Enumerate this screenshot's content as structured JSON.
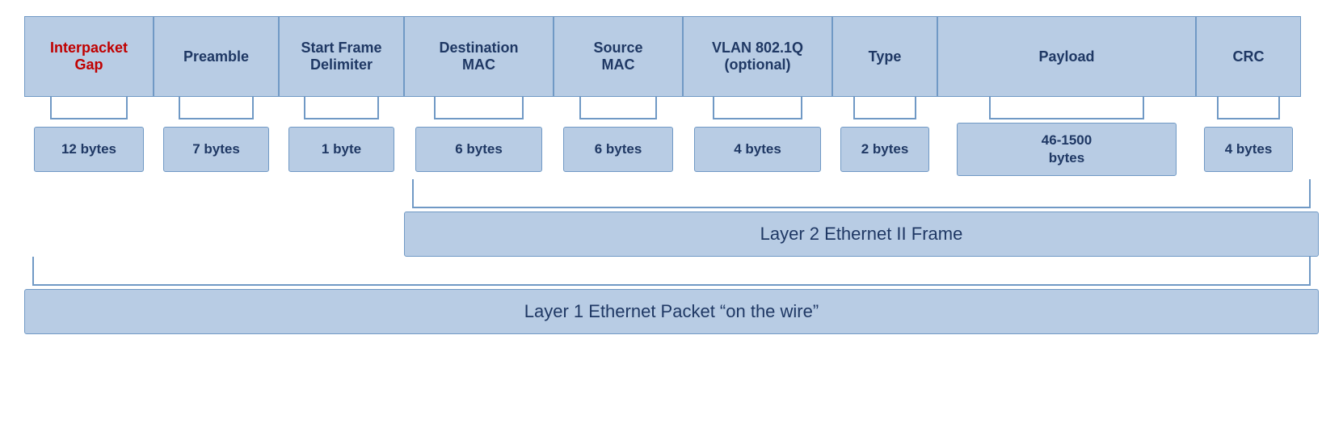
{
  "header": {
    "cells": [
      {
        "id": "interpacket",
        "label": "Interpacket\nGap",
        "special": "red-underline"
      },
      {
        "id": "preamble",
        "label": "Preamble"
      },
      {
        "id": "sfd",
        "label": "Start Frame\nDelimiter"
      },
      {
        "id": "dst-mac",
        "label": "Destination\nMAC"
      },
      {
        "id": "src-mac",
        "label": "Source\nMAC"
      },
      {
        "id": "vlan",
        "label": "VLAN 802.1Q\n(optional)"
      },
      {
        "id": "type",
        "label": "Type"
      },
      {
        "id": "payload",
        "label": "Payload"
      },
      {
        "id": "crc",
        "label": "CRC"
      }
    ]
  },
  "bytes": {
    "cells": [
      {
        "id": "interpacket",
        "label": "12 bytes"
      },
      {
        "id": "preamble",
        "label": "7 bytes"
      },
      {
        "id": "sfd",
        "label": "1 byte"
      },
      {
        "id": "dst-mac",
        "label": "6 bytes"
      },
      {
        "id": "src-mac",
        "label": "6 bytes"
      },
      {
        "id": "vlan",
        "label": "4 bytes"
      },
      {
        "id": "type",
        "label": "2 bytes"
      },
      {
        "id": "payload",
        "label": "46-1500\nbytes"
      },
      {
        "id": "crc",
        "label": "4 bytes"
      }
    ]
  },
  "layer2": {
    "label": "Layer 2 Ethernet II Frame",
    "spacer_cols": [
      "interpacket",
      "preamble",
      "sfd"
    ],
    "span_cols": [
      "dst-mac",
      "src-mac",
      "vlan",
      "type",
      "payload",
      "crc"
    ]
  },
  "layer1": {
    "label": "Layer 1 Ethernet Packet “on the wire”"
  }
}
